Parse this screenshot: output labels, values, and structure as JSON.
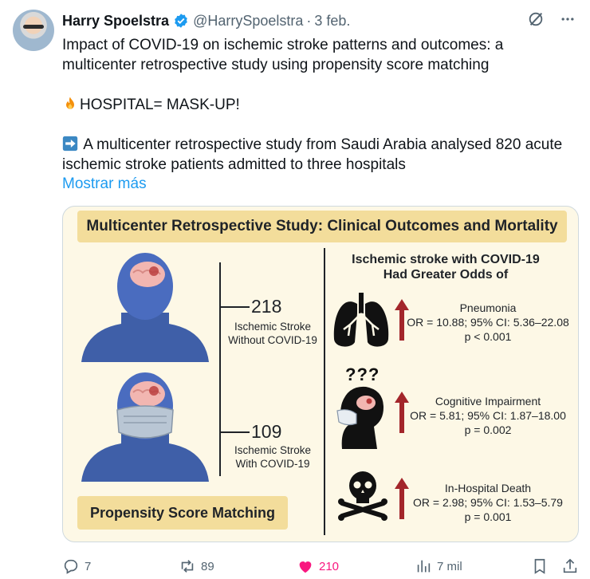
{
  "tweet": {
    "author_name": "Harry Spoelstra",
    "handle": "@HarrySpoelstra",
    "separator": "·",
    "date": "3 feb.",
    "text_line1": "Impact of COVID-19 on ischemic stroke patterns and outcomes: a multicenter retrospective study using propensity score matching",
    "text_line2": "HOSPITAL= MASK-UP!",
    "text_line3": "A multicenter retrospective study from Saudi Arabia analysed 820 acute ischemic stroke patients admitted to three hospitals",
    "show_more": "Mostrar más"
  },
  "infographic": {
    "title": "Multicenter Retrospective Study: Clinical Outcomes and Mortality",
    "group1_count": "218",
    "group1_label_l1": "Ischemic Stroke",
    "group1_label_l2": "Without COVID-19",
    "group2_count": "109",
    "group2_label_l1": "Ischemic Stroke",
    "group2_label_l2": "With COVID-19",
    "footer": "Propensity Score Matching",
    "right_heading_l1": "Ischemic stroke with COVID-19",
    "right_heading_l2": "Had Greater Odds of",
    "outcomes": [
      {
        "name": "Pneumonia",
        "or": "OR = 10.88; 95% CI: 5.36–22.08",
        "p": "p < 0.001"
      },
      {
        "name": "Cognitive Impairment",
        "or": "OR = 5.81; 95% CI: 1.87–18.00",
        "p": "p = 0.002"
      },
      {
        "name": "In-Hospital Death",
        "or": "OR = 2.98; 95% CI: 1.53–5.79",
        "p": "p = 0.001"
      }
    ],
    "question_marks": "???"
  },
  "actions": {
    "replies": "7",
    "retweets": "89",
    "likes": "210",
    "views": "7 mil"
  },
  "colors": {
    "link": "#1d9bf0",
    "like": "#f91880",
    "banner": "#f3dd9b",
    "card_bg": "#fdf8e6",
    "arrow": "#a3262b"
  }
}
